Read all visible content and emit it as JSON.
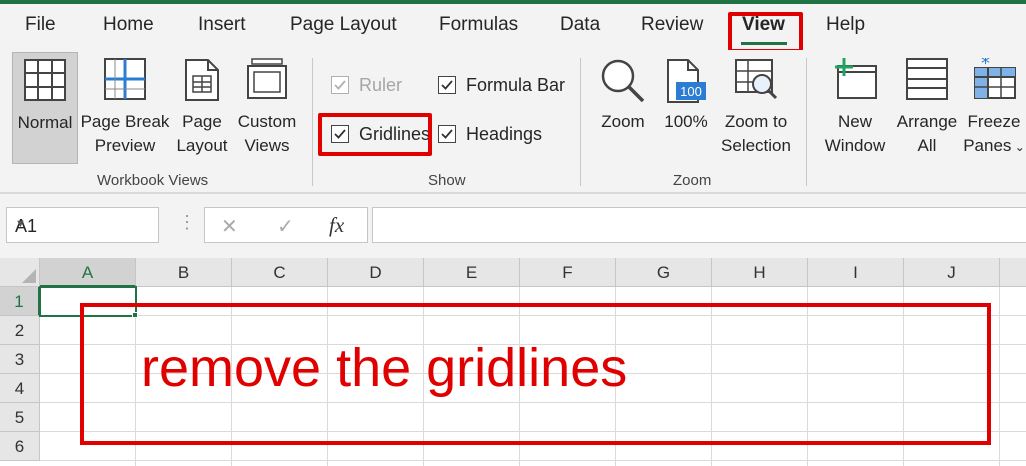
{
  "ribbon_tabs": [
    "File",
    "Home",
    "Insert",
    "Page Layout",
    "Formulas",
    "Data",
    "Review",
    "View",
    "Help"
  ],
  "active_tab": "View",
  "workbook_views": {
    "label": "Workbook Views",
    "buttons": [
      {
        "line1": "Normal",
        "line2": ""
      },
      {
        "line1": "Page Break",
        "line2": "Preview"
      },
      {
        "line1": "Page",
        "line2": "Layout"
      },
      {
        "line1": "Custom",
        "line2": "Views"
      }
    ]
  },
  "show": {
    "label": "Show",
    "ruler": "Ruler",
    "formula_bar": "Formula Bar",
    "gridlines": "Gridlines",
    "headings": "Headings"
  },
  "zoom_group": {
    "label": "Zoom",
    "zoom": "Zoom",
    "hundred": "100%",
    "hundred_icon": "100",
    "selection_line1": "Zoom to",
    "selection_line2": "Selection"
  },
  "window_group": {
    "new_line1": "New",
    "new_line2": "Window",
    "arrange_line1": "Arrange",
    "arrange_line2": "All",
    "freeze_line1": "Freeze",
    "freeze_line2": "Panes"
  },
  "formula_bar": {
    "name_box": "A1",
    "fx": "fx",
    "cancel": "✕",
    "enter": "✓",
    "formula_value": ""
  },
  "columns": [
    "A",
    "B",
    "C",
    "D",
    "E",
    "F",
    "G",
    "H",
    "I",
    "J"
  ],
  "rows": [
    "1",
    "2",
    "3",
    "4",
    "5",
    "6"
  ],
  "annotation": "remove the gridlines",
  "colors": {
    "accent": "#217346",
    "highlight": "#e00000"
  }
}
